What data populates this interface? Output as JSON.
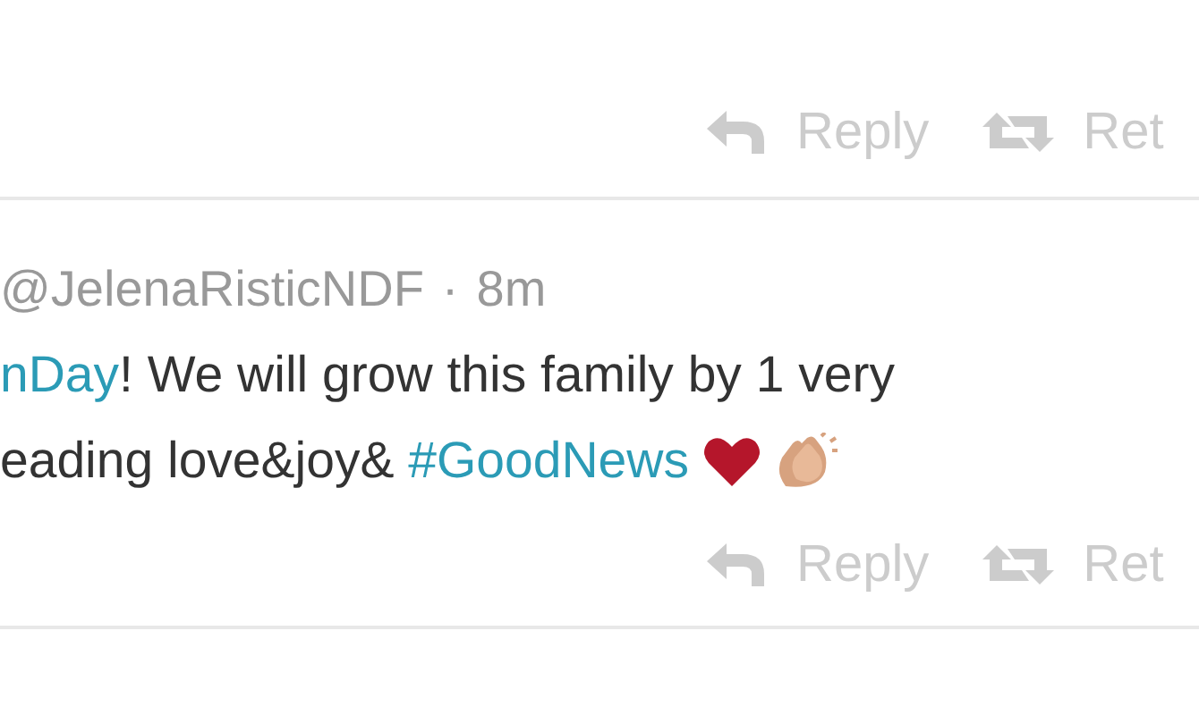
{
  "tweets": [
    {
      "actions": [
        {
          "kind": "reply",
          "label": "Reply"
        },
        {
          "kind": "retweet",
          "label": "Ret"
        }
      ]
    },
    {
      "handle": "@JelenaRisticNDF",
      "separator": "·",
      "time": "8m",
      "lines": [
        [
          {
            "kind": "hashtag",
            "text": "nDay"
          },
          {
            "kind": "plain",
            "text": "! We will grow this family by 1 very"
          }
        ],
        [
          {
            "kind": "plain",
            "text": "eading love&joy& "
          },
          {
            "kind": "hashtag",
            "text": "#GoodNews"
          },
          {
            "kind": "heart"
          },
          {
            "kind": "clap"
          }
        ]
      ],
      "actions": [
        {
          "kind": "reply",
          "label": "Reply"
        },
        {
          "kind": "retweet",
          "label": "Ret"
        }
      ]
    }
  ]
}
